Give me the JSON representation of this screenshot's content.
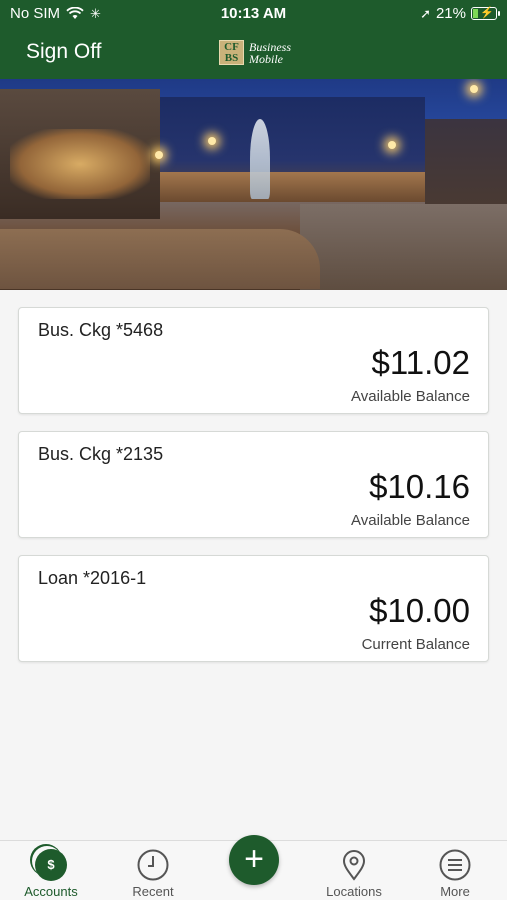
{
  "status_bar": {
    "carrier": "No SIM",
    "time": "10:13 AM",
    "battery": "21%",
    "battery_level": 0.21
  },
  "header": {
    "sign_off": "Sign Off",
    "logo_mark": "CF BS",
    "logo_line1": "Business",
    "logo_line2": "Mobile"
  },
  "accounts": [
    {
      "name": "Bus. Ckg *5468",
      "amount": "$11.02",
      "balance_label": "Available Balance"
    },
    {
      "name": "Bus. Ckg *2135",
      "amount": "$10.16",
      "balance_label": "Available Balance"
    },
    {
      "name": "Loan *2016-1",
      "amount": "$10.00",
      "balance_label": "Current Balance"
    }
  ],
  "tabs": [
    {
      "label": "Accounts",
      "icon": "accounts-icon",
      "active": true
    },
    {
      "label": "Recent",
      "icon": "clock-icon"
    },
    {
      "label": "Locations",
      "icon": "location-pin-icon"
    },
    {
      "label": "More",
      "icon": "menu-icon"
    }
  ],
  "fab": {
    "icon": "plus-icon",
    "symbol": "+"
  },
  "colors": {
    "brand_green": "#1e5b2c",
    "background": "#f5f5f5",
    "card": "#ffffff"
  }
}
